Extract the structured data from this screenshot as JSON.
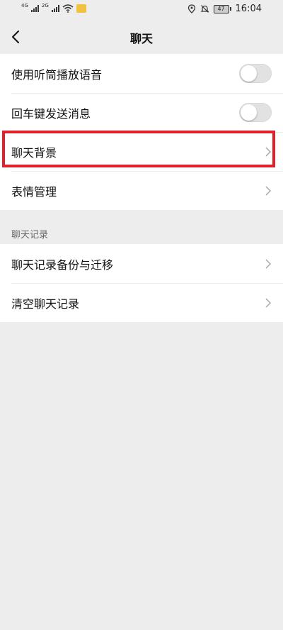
{
  "status_bar": {
    "network_1": "4G",
    "network_2": "2G",
    "battery": "47",
    "time": "16:04"
  },
  "header": {
    "title": "聊天"
  },
  "settings": {
    "group_1": [
      {
        "label": "使用听筒播放语音",
        "type": "toggle",
        "enabled": false
      },
      {
        "label": "回车键发送消息",
        "type": "toggle",
        "enabled": false
      },
      {
        "label": "聊天背景",
        "type": "link",
        "highlighted": true
      },
      {
        "label": "表情管理",
        "type": "link"
      }
    ],
    "section_2_title": "聊天记录",
    "group_2": [
      {
        "label": "聊天记录备份与迁移",
        "type": "link"
      },
      {
        "label": "清空聊天记录",
        "type": "link"
      }
    ]
  },
  "colors": {
    "background": "#ededed",
    "highlight": "#e0202a"
  }
}
